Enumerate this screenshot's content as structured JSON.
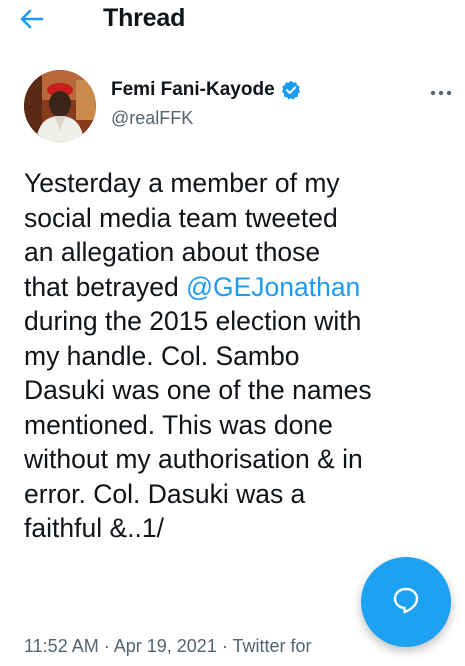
{
  "header": {
    "title": "Thread"
  },
  "tweet": {
    "author": {
      "name": "Femi Fani-Kayode",
      "handle": "@realFFK",
      "verified": true
    },
    "text_part1": "Yesterday a member of my\nsocial media team tweeted\nan allegation about those\nthat betrayed ",
    "mention": "@GEJonathan",
    "text_part2": "\nduring the 2015 election with\nmy handle. Col. Sambo\nDasuki was one of the names\nmentioned. This was done\nwithout my authorisation & in\nerror. Col. Dasuki was a\nfaithful &..1/",
    "time": "11:52 AM",
    "date": "Apr 19, 2021",
    "source": "Twitter for",
    "separator": "·"
  },
  "icons": {
    "back": "arrow-left-icon",
    "verified": "verified-badge-icon",
    "more": "more-horizontal-icon",
    "compose": "reply-bubble-icon"
  },
  "colors": {
    "accent": "#1d9bf0",
    "fab": "#1da1f2",
    "text": "#0f1419",
    "secondary": "#536471"
  }
}
